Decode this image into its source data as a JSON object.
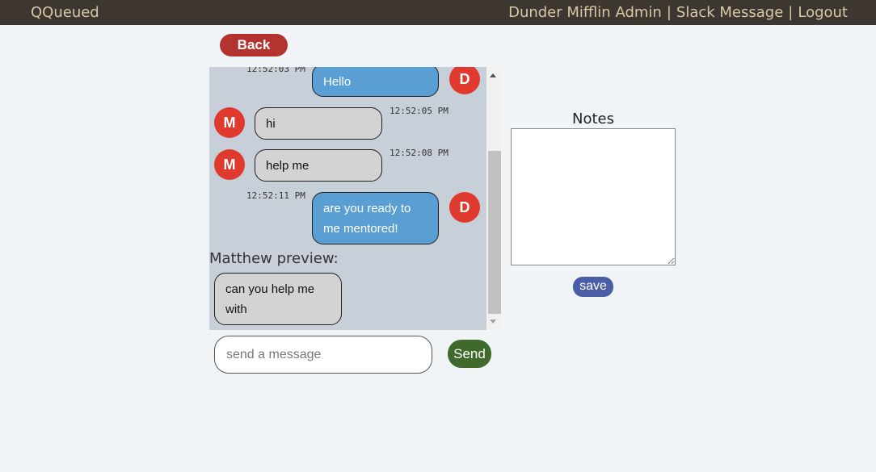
{
  "header": {
    "brand": "QQueued",
    "links": [
      "Dunder Mifflin Admin",
      "Slack Message",
      "Logout"
    ],
    "separator": "|"
  },
  "back_button": {
    "label": "Back"
  },
  "chat": {
    "messages": [
      {
        "sender_initial": "D",
        "direction": "outgoing",
        "text": "Hello",
        "time": "12:52:03 PM"
      },
      {
        "sender_initial": "M",
        "direction": "incoming",
        "text": "hi",
        "time": "12:52:05 PM"
      },
      {
        "sender_initial": "M",
        "direction": "incoming",
        "text": "help me",
        "time": "12:52:08 PM"
      },
      {
        "sender_initial": "D",
        "direction": "outgoing",
        "text": "are you ready to me mentored!",
        "time": "12:52:11 PM"
      }
    ],
    "preview_label": "Matthew preview:",
    "preview_text": "can you help me with"
  },
  "composer": {
    "placeholder": "send a message",
    "send_label": "Send"
  },
  "notes": {
    "title": "Notes",
    "value": "",
    "save_label": "save"
  },
  "colors": {
    "topbar": "#3d3631",
    "topbar_text": "#d7c9a5",
    "back_button": "#b3342f",
    "avatar": "#e03a2f",
    "outgoing_bubble": "#5a9fd4",
    "incoming_bubble": "#d3d3d3",
    "chat_background": "#c7cfd9",
    "send_button": "#3f6a2c",
    "save_button": "#4a5ea8"
  }
}
